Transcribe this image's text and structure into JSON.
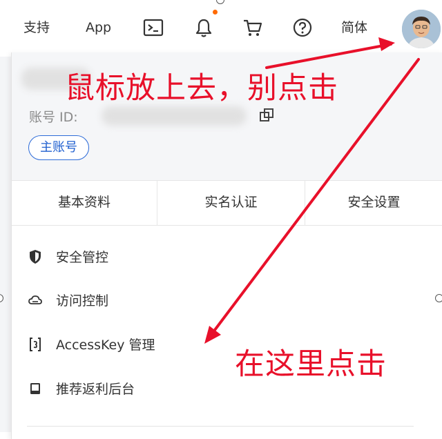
{
  "nav": {
    "support": "支持",
    "app": "App",
    "language": "简体",
    "icons": [
      "terminal-icon",
      "bell-icon",
      "cart-icon",
      "help-icon"
    ]
  },
  "account": {
    "id_label": "账号 ID:",
    "role_badge": "主账号"
  },
  "tabs": [
    "基本资料",
    "实名认证",
    "安全设置"
  ],
  "menu": [
    {
      "label": "安全管控",
      "icon": "shield-icon"
    },
    {
      "label": "访问控制",
      "icon": "cloud-icon"
    },
    {
      "label": "AccessKey 管理",
      "icon": "key-icon"
    },
    {
      "label": "推荐返利后台",
      "icon": "monitor-icon"
    }
  ],
  "annotations": {
    "hover": "鼠标放上去，别点击",
    "click": "在这里点击"
  },
  "colors": {
    "annotation": "#e8102a",
    "accent": "#1f5fcf",
    "notification_dot": "#ff6a00"
  }
}
